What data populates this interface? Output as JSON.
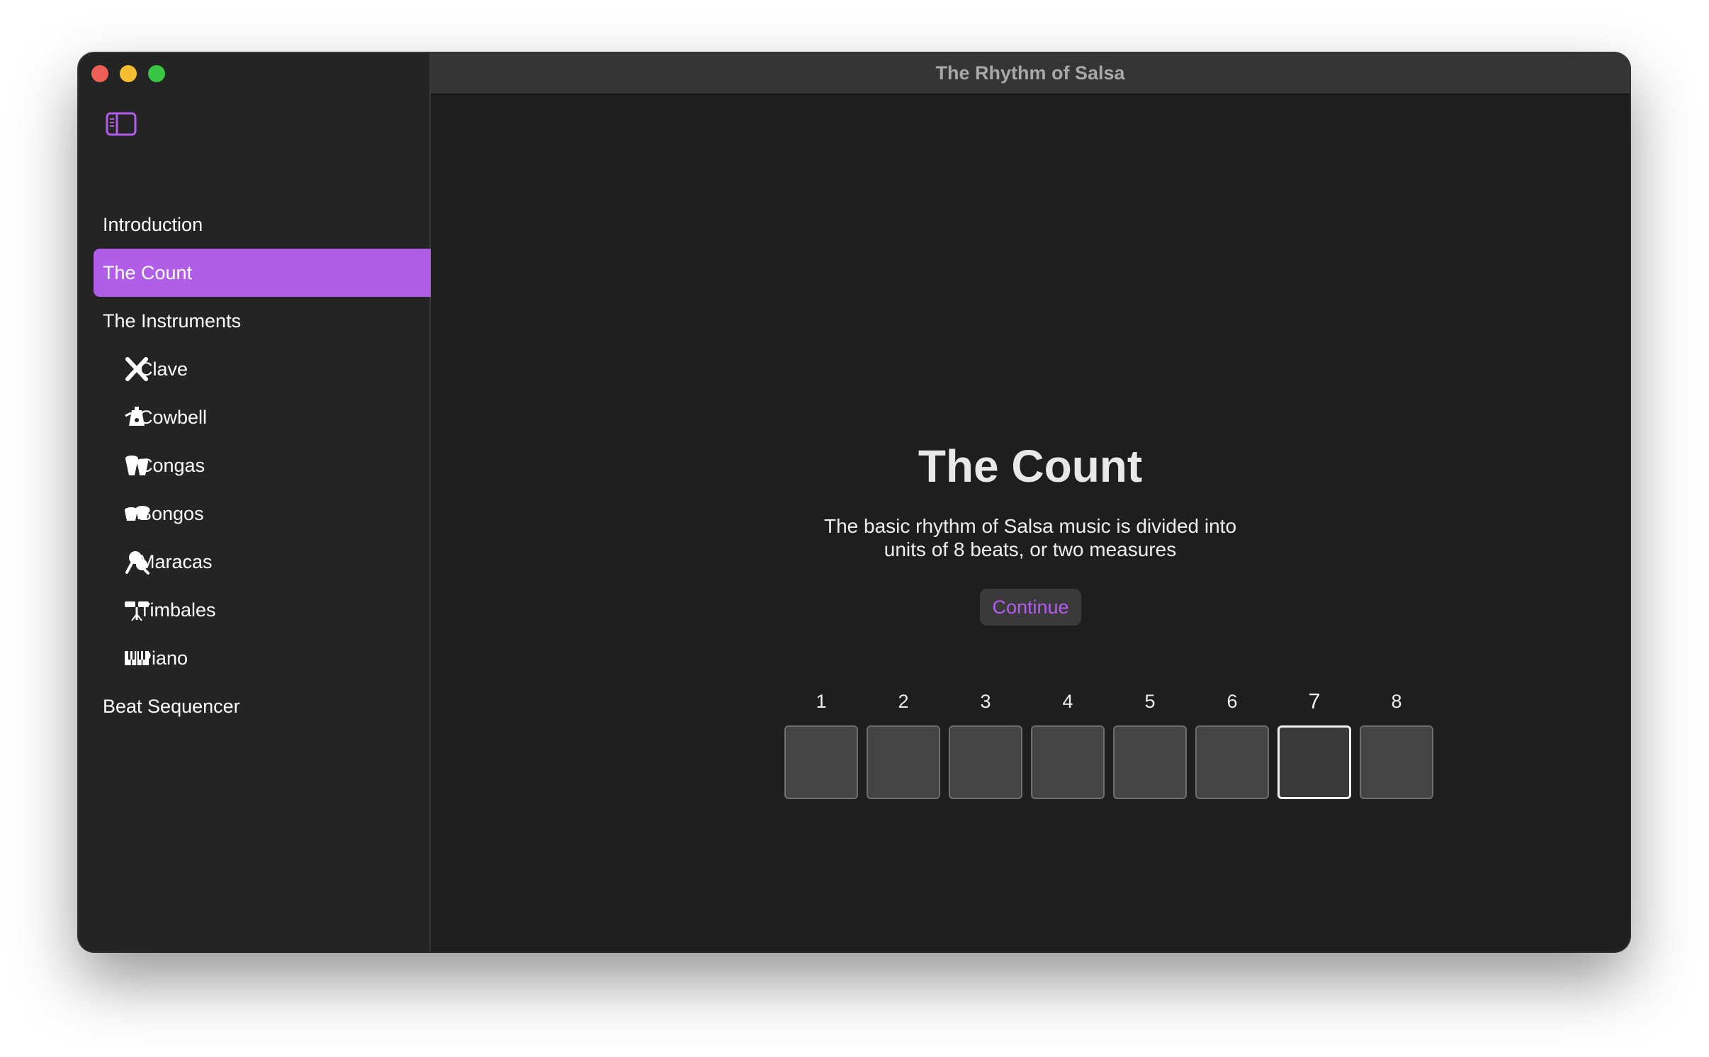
{
  "window": {
    "title": "The Rhythm of Salsa"
  },
  "sidebar": {
    "items": [
      {
        "label": "Introduction"
      },
      {
        "label": "The Count",
        "selected": true
      },
      {
        "label": "The Instruments",
        "expanded": true
      },
      {
        "label": "Clave",
        "icon": "clave-icon"
      },
      {
        "label": "Cowbell",
        "icon": "cowbell-icon"
      },
      {
        "label": "Congas",
        "icon": "congas-icon"
      },
      {
        "label": "Bongos",
        "icon": "bongos-icon"
      },
      {
        "label": "Maracas",
        "icon": "maracas-icon"
      },
      {
        "label": "Timbales",
        "icon": "timbales-icon"
      },
      {
        "label": "Piano",
        "icon": "piano-icon"
      },
      {
        "label": "Beat Sequencer"
      }
    ]
  },
  "main": {
    "heading": "The Count",
    "description": "The basic rhythm of Salsa music is divided into units of 8 beats, or two measures",
    "continue_label": "Continue",
    "beats": [
      "1",
      "2",
      "3",
      "4",
      "5",
      "6",
      "7",
      "8"
    ],
    "active_beat": "7"
  },
  "colors": {
    "accent": "#b05ee7",
    "continue_text": "#b45cf0",
    "window_bg": "#1e1e1e",
    "sidebar_bg": "#242424"
  }
}
